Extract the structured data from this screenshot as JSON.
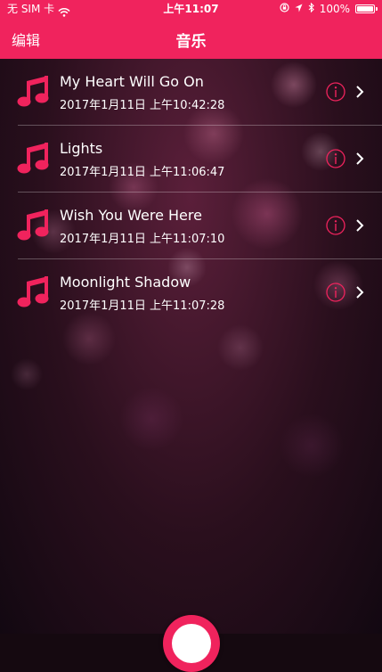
{
  "status_bar": {
    "carrier": "无 SIM 卡",
    "time": "上午11:07",
    "battery": "100%"
  },
  "nav": {
    "edit_label": "编辑",
    "title": "音乐"
  },
  "songs": [
    {
      "title": "My Heart Will Go On",
      "date": "2017年1月11日 上午10:42:28"
    },
    {
      "title": "Lights",
      "date": "2017年1月11日 上午11:06:47"
    },
    {
      "title": "Wish You Were Here",
      "date": "2017年1月11日 上午11:07:10"
    },
    {
      "title": "Moonlight Shadow",
      "date": "2017年1月11日 上午11:07:28"
    }
  ],
  "icons": {
    "song": "music-note-icon",
    "info": "info-icon",
    "detail": "chevron-right-icon"
  },
  "colors": {
    "accent": "#f0235d",
    "text": "#ffffff"
  }
}
